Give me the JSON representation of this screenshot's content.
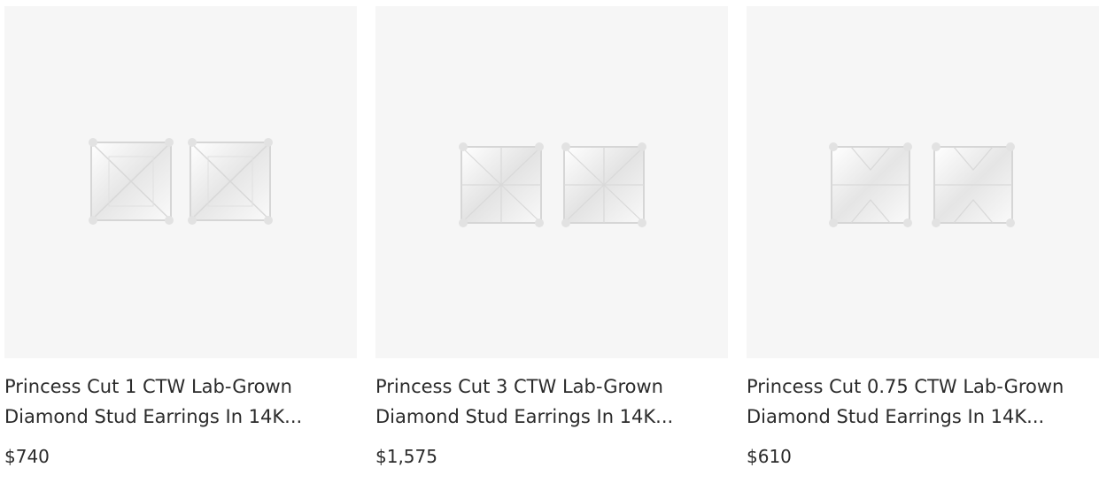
{
  "products": [
    {
      "title": "Princess Cut 1 CTW Lab-Grown Diamond Stud Earrings In 14K...",
      "price": "$740",
      "image_icon": "princess-cut-stud-earrings-image"
    },
    {
      "title": "Princess Cut 3 CTW Lab-Grown Diamond Stud Earrings In 14K...",
      "price": "$1,575",
      "image_icon": "princess-cut-stud-earrings-image"
    },
    {
      "title": "Princess Cut 0.75 CTW Lab-Grown Diamond Stud Earrings In 14K...",
      "price": "$610",
      "image_icon": "princess-cut-stud-earrings-image"
    }
  ],
  "colors": {
    "image_background": "#f6f6f6",
    "text": "#2b2b2b"
  }
}
